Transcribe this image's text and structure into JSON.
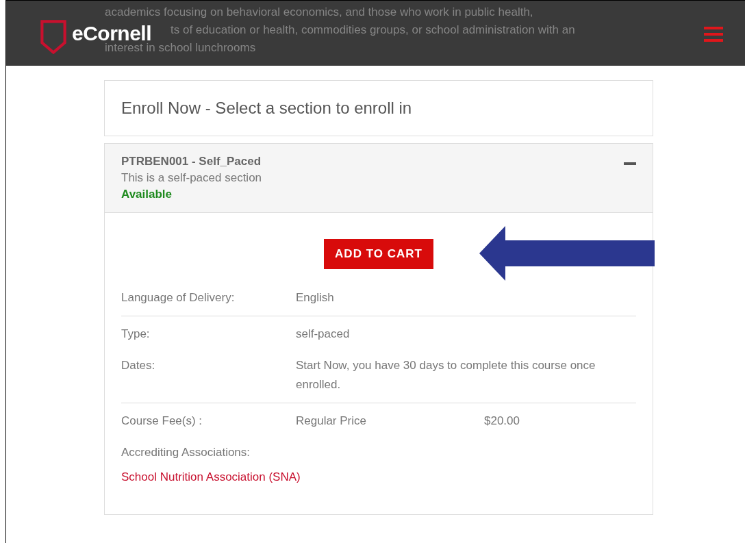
{
  "background_text": [
    "academics focusing on behavioral economics, and those who work in public health,",
    "ts of education or health, commodities groups, or school administration with an",
    "interest in school lunchrooms"
  ],
  "header": {
    "logo": "eCornell"
  },
  "enroll": {
    "title": "Enroll Now - Select a section to enroll in"
  },
  "section": {
    "code": "PTRBEN001 - Self_Paced",
    "description": "This is a self-paced section",
    "status": "Available",
    "expanded": true,
    "button": "ADD TO CART",
    "detail_groups": [
      [
        {
          "label": "Language of Delivery:",
          "value": "English"
        }
      ],
      [
        {
          "label": "Type:",
          "value": "self-paced"
        },
        {
          "label": "Dates:",
          "value": "Start Now, you have 30 days to complete this course once enrolled."
        }
      ],
      [
        {
          "label": "Course Fee(s) :",
          "value": "Regular Price",
          "price": "$20.00"
        },
        {
          "label": "Accrediting Associations:"
        }
      ]
    ],
    "association": "School Nutrition Association (SNA)"
  }
}
